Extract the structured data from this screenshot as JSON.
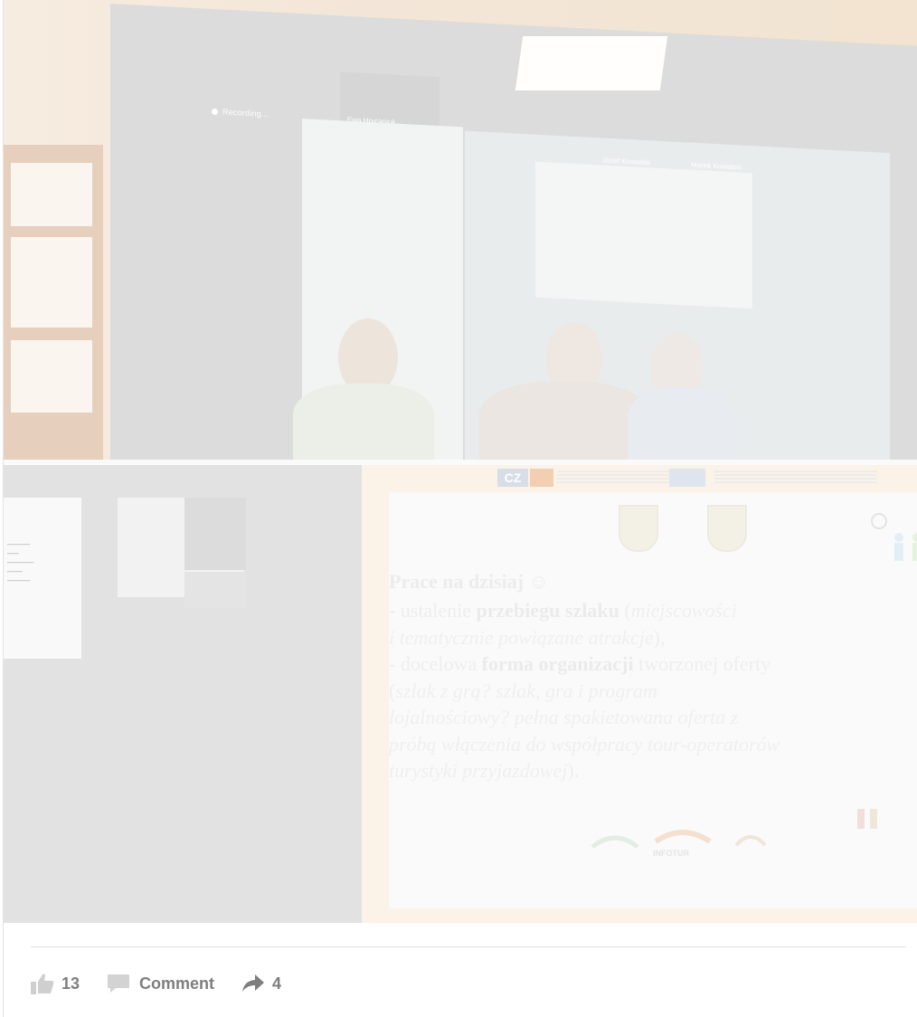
{
  "post": {
    "top_image": {
      "recording_label": "Recording...",
      "name_tags": [
        "Ewa Hrycaniuk",
        "Józef Kowalski",
        "Marek Kowalski"
      ]
    },
    "bottom_image": {
      "slide": {
        "title": "Prace na dzisiaj ☺",
        "lines": [
          {
            "parts": [
              {
                "t": "- ustalenie ",
                "s": "n"
              },
              {
                "t": "przebiegu szlaku",
                "s": "b"
              },
              {
                "t": " (",
                "s": "n"
              },
              {
                "t": "miejscowości",
                "s": "i"
              }
            ]
          },
          {
            "parts": [
              {
                "t": "i tematycznie powiązane atrakcje",
                "s": "i"
              },
              {
                "t": "),",
                "s": "n"
              }
            ]
          },
          {
            "parts": [
              {
                "t": "- docelowa ",
                "s": "n"
              },
              {
                "t": "forma organizacji",
                "s": "b"
              },
              {
                "t": " tworzonej oferty",
                "s": "n"
              }
            ]
          },
          {
            "parts": [
              {
                "t": "(",
                "s": "n"
              },
              {
                "t": "szlak z grą? szlak, gra i program",
                "s": "i"
              }
            ]
          },
          {
            "parts": [
              {
                "t": "lojalnościowy? pełna spakietowana oferta z",
                "s": "i"
              }
            ]
          },
          {
            "parts": [
              {
                "t": "próbą włączenia do współpracy tour-operatorów",
                "s": "i"
              }
            ]
          },
          {
            "parts": [
              {
                "t": "turystyki przyjazdowej",
                "s": "i"
              },
              {
                "t": ").",
                "s": "n"
              }
            ]
          }
        ],
        "logo_cz": "CZ",
        "footer_logo": "INFOTUR"
      }
    },
    "actions": {
      "like_count": "13",
      "comment_label": "Comment",
      "share_count": "4"
    },
    "colors": {
      "action_text": "#7e7e7e",
      "icon_fill": "#c9c9c9"
    }
  }
}
